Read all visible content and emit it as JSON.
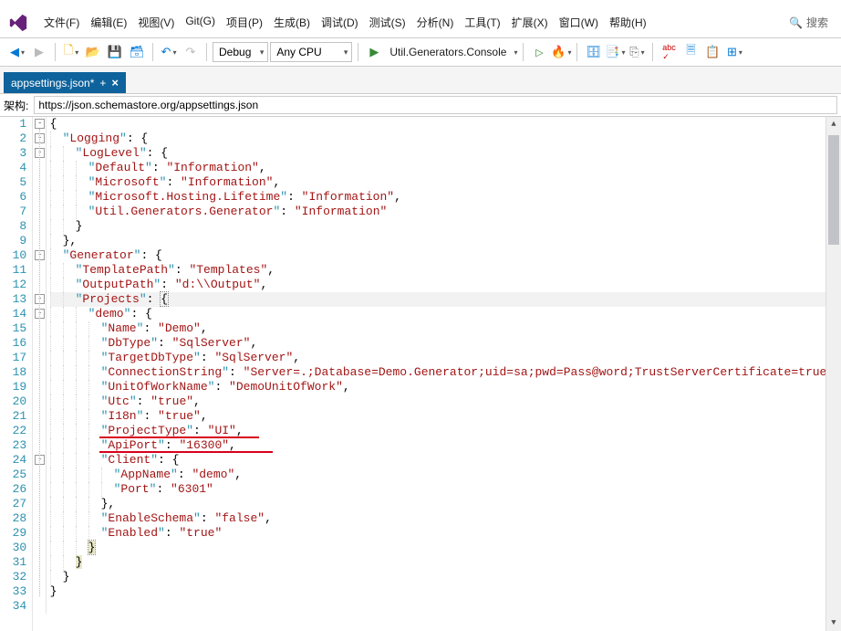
{
  "menu": {
    "items": [
      "文件(F)",
      "编辑(E)",
      "视图(V)",
      "Git(G)",
      "项目(P)",
      "生成(B)",
      "调试(D)",
      "测试(S)",
      "分析(N)",
      "工具(T)",
      "扩展(X)",
      "窗口(W)",
      "帮助(H)"
    ],
    "search": "搜索"
  },
  "toolbar": {
    "config": "Debug",
    "platform": "Any CPU",
    "run_target": "Util.Generators.Console"
  },
  "tab": {
    "title": "appsettings.json*",
    "dirty": "+"
  },
  "schema": {
    "label": "架构:",
    "url": "https://json.schemastore.org/appsettings.json"
  },
  "code": {
    "lines": 34,
    "json": {
      "Logging": {
        "LogLevel": {
          "Default": "Information",
          "Microsoft": "Information",
          "Microsoft.Hosting.Lifetime": "Information",
          "Util.Generators.Generator": "Information"
        }
      },
      "Generator": {
        "TemplatePath": "Templates",
        "OutputPath": "d:\\\\Output",
        "Projects": {
          "demo": {
            "Name": "Demo",
            "DbType": "SqlServer",
            "TargetDbType": "SqlServer",
            "ConnectionString": "Server=.;Database=Demo.Generator;uid=sa;pwd=Pass@word;TrustServerCertificate=true",
            "UnitOfWorkName": "DemoUnitOfWork",
            "Utc": "true",
            "I18n": "true",
            "ProjectType": "UI",
            "ApiPort": "16300",
            "Client": {
              "AppName": "demo",
              "Port": "6301"
            },
            "EnableSchema": "false",
            "Enabled": "true"
          }
        }
      }
    }
  }
}
